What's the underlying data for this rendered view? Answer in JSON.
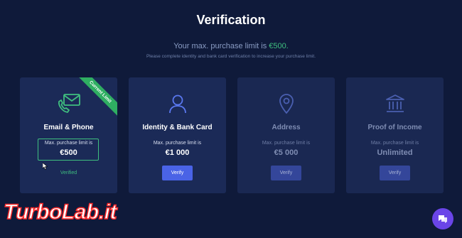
{
  "header": {
    "title": "Verification",
    "limit_prefix": "Your max. purchase limit is ",
    "limit_amount": "€500.",
    "subtitle": "Please complete identity and bank card verification to increase your purchase limit."
  },
  "cards": [
    {
      "name": "Email & Phone",
      "limit_label": "Max. purchase limit is",
      "limit_value": "€500",
      "status": "Verified",
      "ribbon": "Current Limit",
      "icon": "phone-mail-icon"
    },
    {
      "name": "Identity & Bank Card",
      "limit_label": "Max. purchase limit is",
      "limit_value": "€1 000",
      "button": "Verify",
      "icon": "user-icon"
    },
    {
      "name": "Address",
      "limit_label": "Max. purchase limit is",
      "limit_value": "€5 000",
      "button": "Verify",
      "icon": "location-pin-icon"
    },
    {
      "name": "Proof of Income",
      "limit_label": "Max. purchase limit is",
      "limit_value": "Unlimited",
      "button": "Verify",
      "icon": "bank-icon"
    }
  ],
  "watermark": "TurboLab.it",
  "chat_icon": "chat-icon",
  "colors": {
    "background": "#0f1a3a",
    "card": "#1b2a57",
    "accent_green": "#3fbf7f",
    "button_blue": "#4a63e6",
    "chat_purple": "#6a45e8"
  }
}
